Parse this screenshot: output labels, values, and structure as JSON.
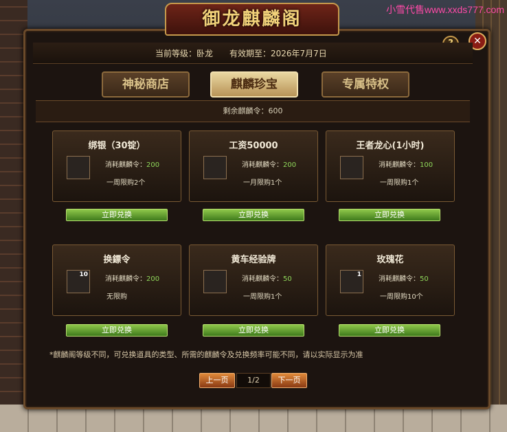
{
  "watermark": "小雪代售www.xxds777.com",
  "window": {
    "title": "御龙麒麟阁",
    "help_label": "?",
    "close_label": "✕"
  },
  "header": {
    "level_text": "当前等级：卧龙",
    "expire_text": "有效期至：2026年7月7日"
  },
  "tabs": [
    {
      "label": "神秘商店",
      "active": false
    },
    {
      "label": "麒麟珍宝",
      "active": true
    },
    {
      "label": "专属特权",
      "active": false
    }
  ],
  "remaining_text": "剩余麒麟令：600",
  "cost_label": "消耗麒麟令：",
  "items": [
    {
      "name": "绑银（30锭）",
      "cost": "200",
      "limit": "一周限购2个",
      "icon": "silver-ingot-icon",
      "badge": ""
    },
    {
      "name": "工资50000",
      "cost": "200",
      "limit": "一月限购1个",
      "icon": "gold-ingot-icon",
      "badge": ""
    },
    {
      "name": "王者龙心(1小时)",
      "cost": "100",
      "limit": "一周限购1个",
      "icon": "dragon-heart-icon",
      "badge": ""
    },
    {
      "name": "换鏢令",
      "cost": "200",
      "limit": "无限购",
      "icon": "token-coin-icon",
      "badge": "10"
    },
    {
      "name": "黄车经验牌",
      "cost": "50",
      "limit": "一周限购1个",
      "icon": "yellow-cart-icon",
      "badge": ""
    },
    {
      "name": "玫瑰花",
      "cost": "50",
      "limit": "一周限购10个",
      "icon": "rose-icon",
      "badge": "1"
    }
  ],
  "exchange_label": "立即兑换",
  "note": "*麒麟阁等级不同，可兑换道具的类型、所需的麒麟令及兑换频率可能不同，请以实际显示为准",
  "pager": {
    "prev_label": "上一页",
    "page": "1/2",
    "next_label": "下一页"
  }
}
